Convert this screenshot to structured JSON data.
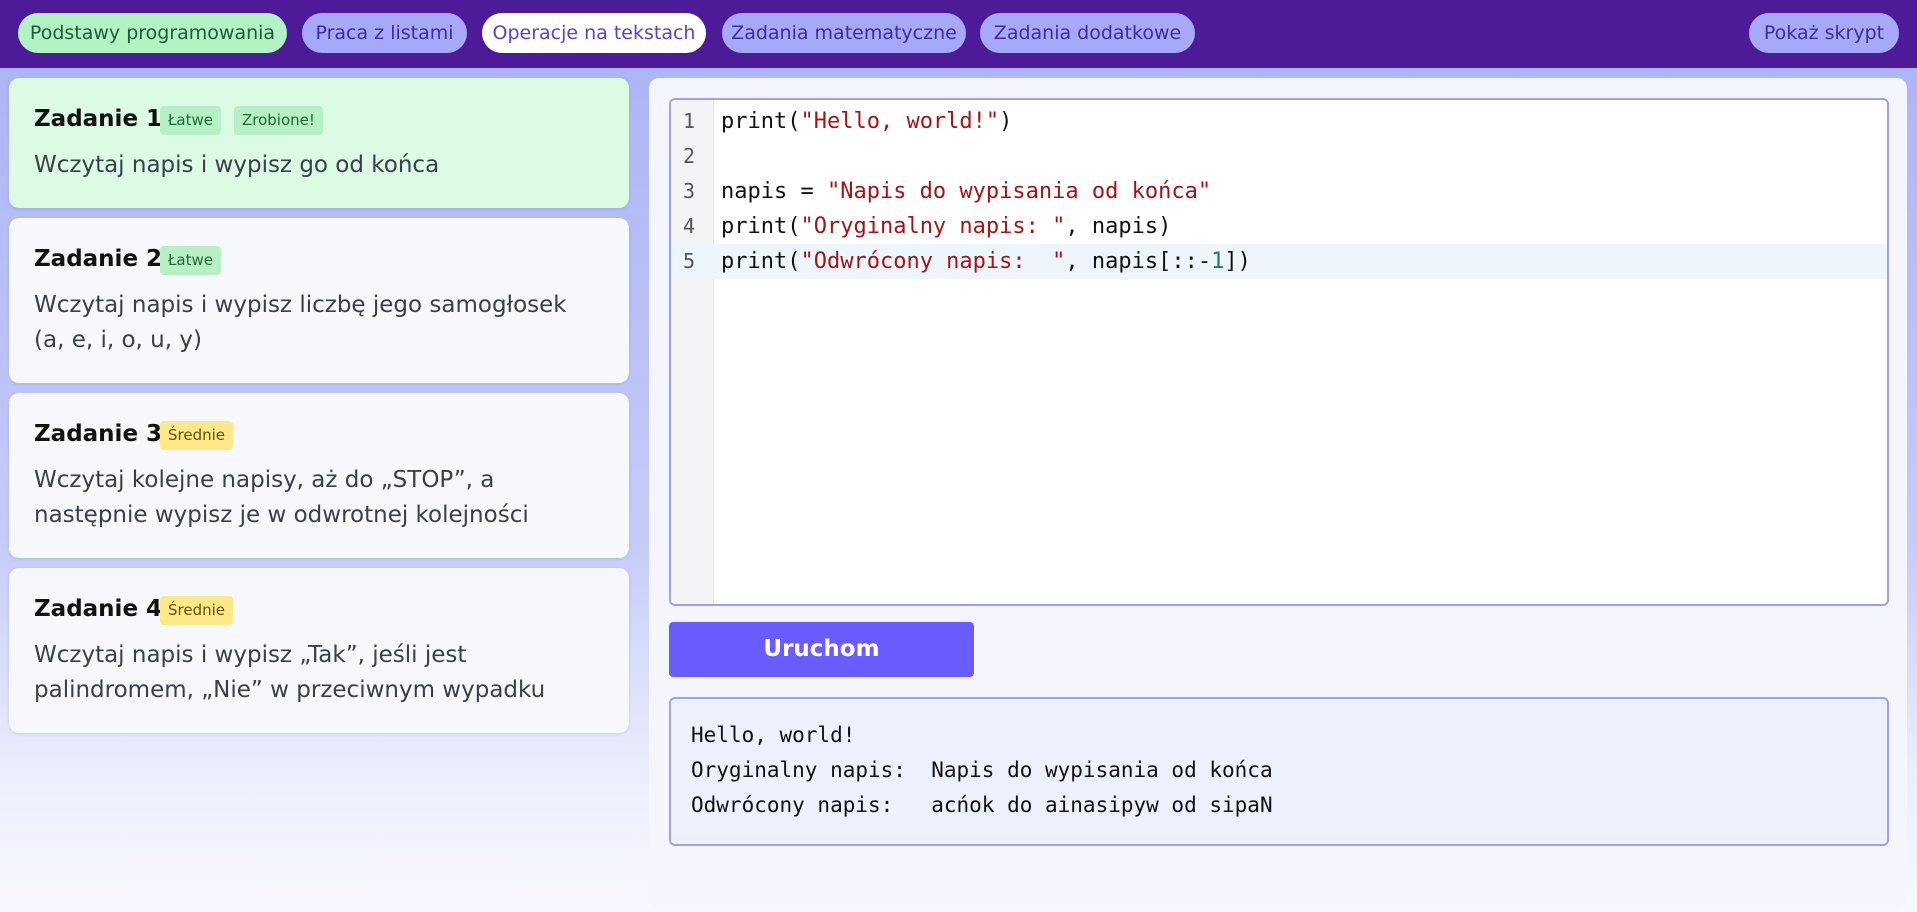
{
  "nav": {
    "tabs": [
      {
        "label": "Podstawy programowania"
      },
      {
        "label": "Praca z listami"
      },
      {
        "label": "Operacje na tekstach"
      },
      {
        "label": "Zadania matematyczne"
      },
      {
        "label": "Zadania dodatkowe"
      }
    ],
    "active_tab": "Operacje na tekstach",
    "show_script_label": "Pokaż skrypt"
  },
  "tasks": [
    {
      "title": "Zadanie 1",
      "difficulty": "Łatwe",
      "status": "Zrobione!",
      "description": "Wczytaj napis i wypisz go od końca"
    },
    {
      "title": "Zadanie 2",
      "difficulty": "Łatwe",
      "description": "Wczytaj napis i wypisz liczbę jego samogłosek (a, e, i, o, u, y)"
    },
    {
      "title": "Zadanie 3",
      "difficulty": "Średnie",
      "description": "Wczytaj kolejne napisy, aż do „STOP”, a następnie wypisz je w odwrotnej kolejności"
    },
    {
      "title": "Zadanie 4",
      "difficulty": "Średnie",
      "description": "Wczytaj napis i wypisz „Tak”, jeśli jest palindromem, „Nie” w przeciwnym wypadku"
    }
  ],
  "editor": {
    "line_numbers": [
      "1",
      "2",
      "3",
      "4",
      "5"
    ],
    "code": [
      "print(\"Hello, world!\")",
      "",
      "napis = \"Napis do wypisania od końca\"",
      "print(\"Oryginalny napis: \", napis)",
      "print(\"Odwrócony napis:  \", napis[::-1])"
    ],
    "active_line": 5
  },
  "run_button_label": "Uruchom",
  "output_lines": [
    "Hello, world!",
    "Oryginalny napis:  Napis do wypisania od końca",
    "Odwrócony napis:   acńok do ainasipyw od sipaN"
  ],
  "colors": {
    "topbar": "#4d1a98",
    "tab_green": "#b3f2c4",
    "tab_purple": "#a7a9f8",
    "run_button": "#6b5cff",
    "task_done_bg": "#dbfbe4"
  }
}
